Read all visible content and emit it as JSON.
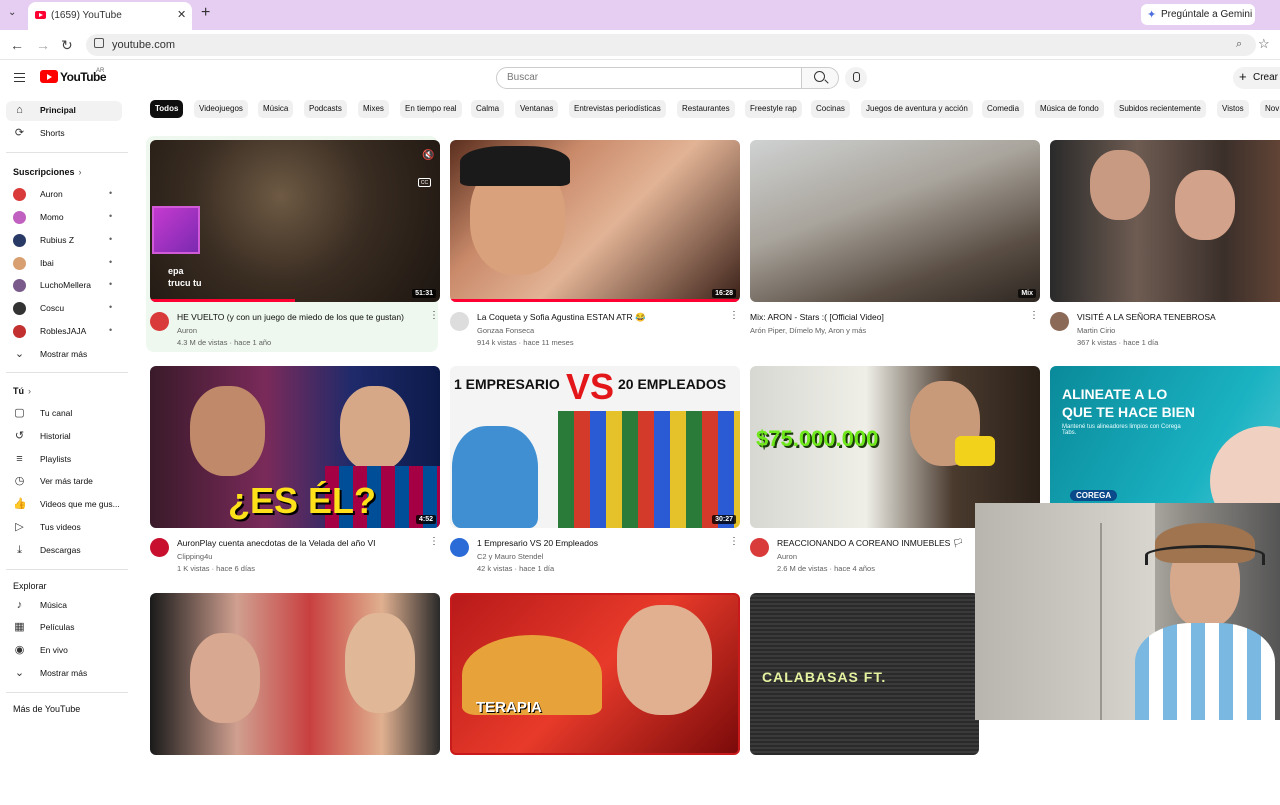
{
  "browser": {
    "tab_title": "(1659) YouTube",
    "url": "youtube.com",
    "gemini_label": "Pregúntale a Gemini"
  },
  "masthead": {
    "logo_text": "YouTube",
    "country_code": "AR",
    "search_placeholder": "Buscar",
    "create_label": "Crear"
  },
  "sidebar": {
    "main": [
      {
        "label": "Principal",
        "icon": "home-icon"
      },
      {
        "label": "Shorts",
        "icon": "shorts-icon"
      }
    ],
    "subscriptions_header": "Suscripciones",
    "subscriptions": [
      {
        "label": "Auron",
        "color": "#d93a3a"
      },
      {
        "label": "Momo",
        "color": "#c060c0"
      },
      {
        "label": "Rubius Z",
        "color": "#2a3a66"
      },
      {
        "label": "Ibai",
        "color": "#d8a070"
      },
      {
        "label": "LuchoMellera",
        "color": "#7a5a8a"
      },
      {
        "label": "Coscu",
        "color": "#333333"
      },
      {
        "label": "RoblesJAJA",
        "color": "#c23030"
      }
    ],
    "show_more": "Mostrar más",
    "you_header": "Tú",
    "you": [
      {
        "label": "Tu canal",
        "icon": "channel-icon"
      },
      {
        "label": "Historial",
        "icon": "history-icon"
      },
      {
        "label": "Playlists",
        "icon": "playlists-icon"
      },
      {
        "label": "Ver más tarde",
        "icon": "watch-later-icon"
      },
      {
        "label": "Videos que me gus...",
        "icon": "like-icon"
      },
      {
        "label": "Tus videos",
        "icon": "your-videos-icon"
      },
      {
        "label": "Descargas",
        "icon": "download-icon"
      }
    ],
    "explore_header": "Explorar",
    "explore": [
      {
        "label": "Música",
        "icon": "music-icon"
      },
      {
        "label": "Películas",
        "icon": "movies-icon"
      },
      {
        "label": "En vivo",
        "icon": "live-icon"
      }
    ],
    "show_more_2": "Mostrar más",
    "more_header": "Más de YouTube"
  },
  "chips": [
    "Todos",
    "Videojuegos",
    "Música",
    "Podcasts",
    "Mixes",
    "En tiempo real",
    "Calma",
    "Ventanas",
    "Entrevistas periodísticas",
    "Restaurantes",
    "Freestyle rap",
    "Cocinas",
    "Juegos de aventura y acción",
    "Comedia",
    "Música de fondo",
    "Subidos recientemente",
    "Vistos",
    "Nov"
  ],
  "videos": [
    {
      "title": "HE VUELTO (y con un juego de miedo de los que te gustan)",
      "channel": "Auron",
      "meta": "4.3 M de vistas · hace 1 año",
      "duration": "51:31",
      "thumb_caption": "epa\ntrucu tu",
      "avatar_color": "#d93a3a"
    },
    {
      "title": "La Coqueta y Sofia Agustina ESTAN ATR 😂",
      "channel": "Gonzaa Fonseca",
      "meta": "914 k vistas · hace 11 meses",
      "duration": "16:28",
      "avatar_color": "#dddddd"
    },
    {
      "title": "Mix: ARON - Stars :( [Official Video]",
      "channel": "Arón Piper, Dímelo My, Aron y más",
      "meta": "",
      "duration": "Mix"
    },
    {
      "title": "VISITÉ A LA SEÑORA TENEBROSA",
      "channel": "Martin Cirio",
      "meta": "367 k vistas · hace 1 día",
      "duration": "",
      "avatar_color": "#8c6a58"
    },
    {
      "title": "AuronPlay cuenta anecdotas de la Velada del año VI",
      "channel": "Clipping4u",
      "meta": "1 K vistas · hace 6 días",
      "duration": "4:52",
      "thumb_caption": "¿ES ÉL?",
      "avatar_color": "#c8102e"
    },
    {
      "title": "1 Empresario VS 20 Empleados",
      "channel": "C2 y Mauro Stendel",
      "meta": "42 k vistas · hace 1 día",
      "duration": "30:27",
      "thumb_caption_left": "1 EMPRESARIO",
      "thumb_caption_vs": "VS",
      "thumb_caption_right": "20 EMPLEADOS",
      "avatar_color": "#2a6bd8"
    },
    {
      "title": "REACCIONANDO A COREANO INMUEBLES 🏳",
      "channel": "Auron",
      "meta": "2.6 M de vistas · hace 4 años",
      "duration": "",
      "thumb_caption": "$75.000.000",
      "avatar_color": "#d93a3a"
    },
    {
      "title": "",
      "channel": "",
      "meta": "",
      "duration": "",
      "thumb_caption_line1": "ALINEATE A LO",
      "thumb_caption_line2": "QUE TE HACE BIEN",
      "thumb_caption_small": "Mantené tus alineadores limpios con Corega Tabs.",
      "thumb_brand": "COREGA"
    },
    {
      "title": "",
      "channel": "",
      "meta": "",
      "duration": ""
    },
    {
      "title": "",
      "channel": "",
      "meta": "",
      "duration": "",
      "thumb_caption": "TERAPIA"
    },
    {
      "title": "",
      "channel": "",
      "meta": "",
      "duration": "",
      "thumb_caption": "CALABASAS FT."
    }
  ]
}
